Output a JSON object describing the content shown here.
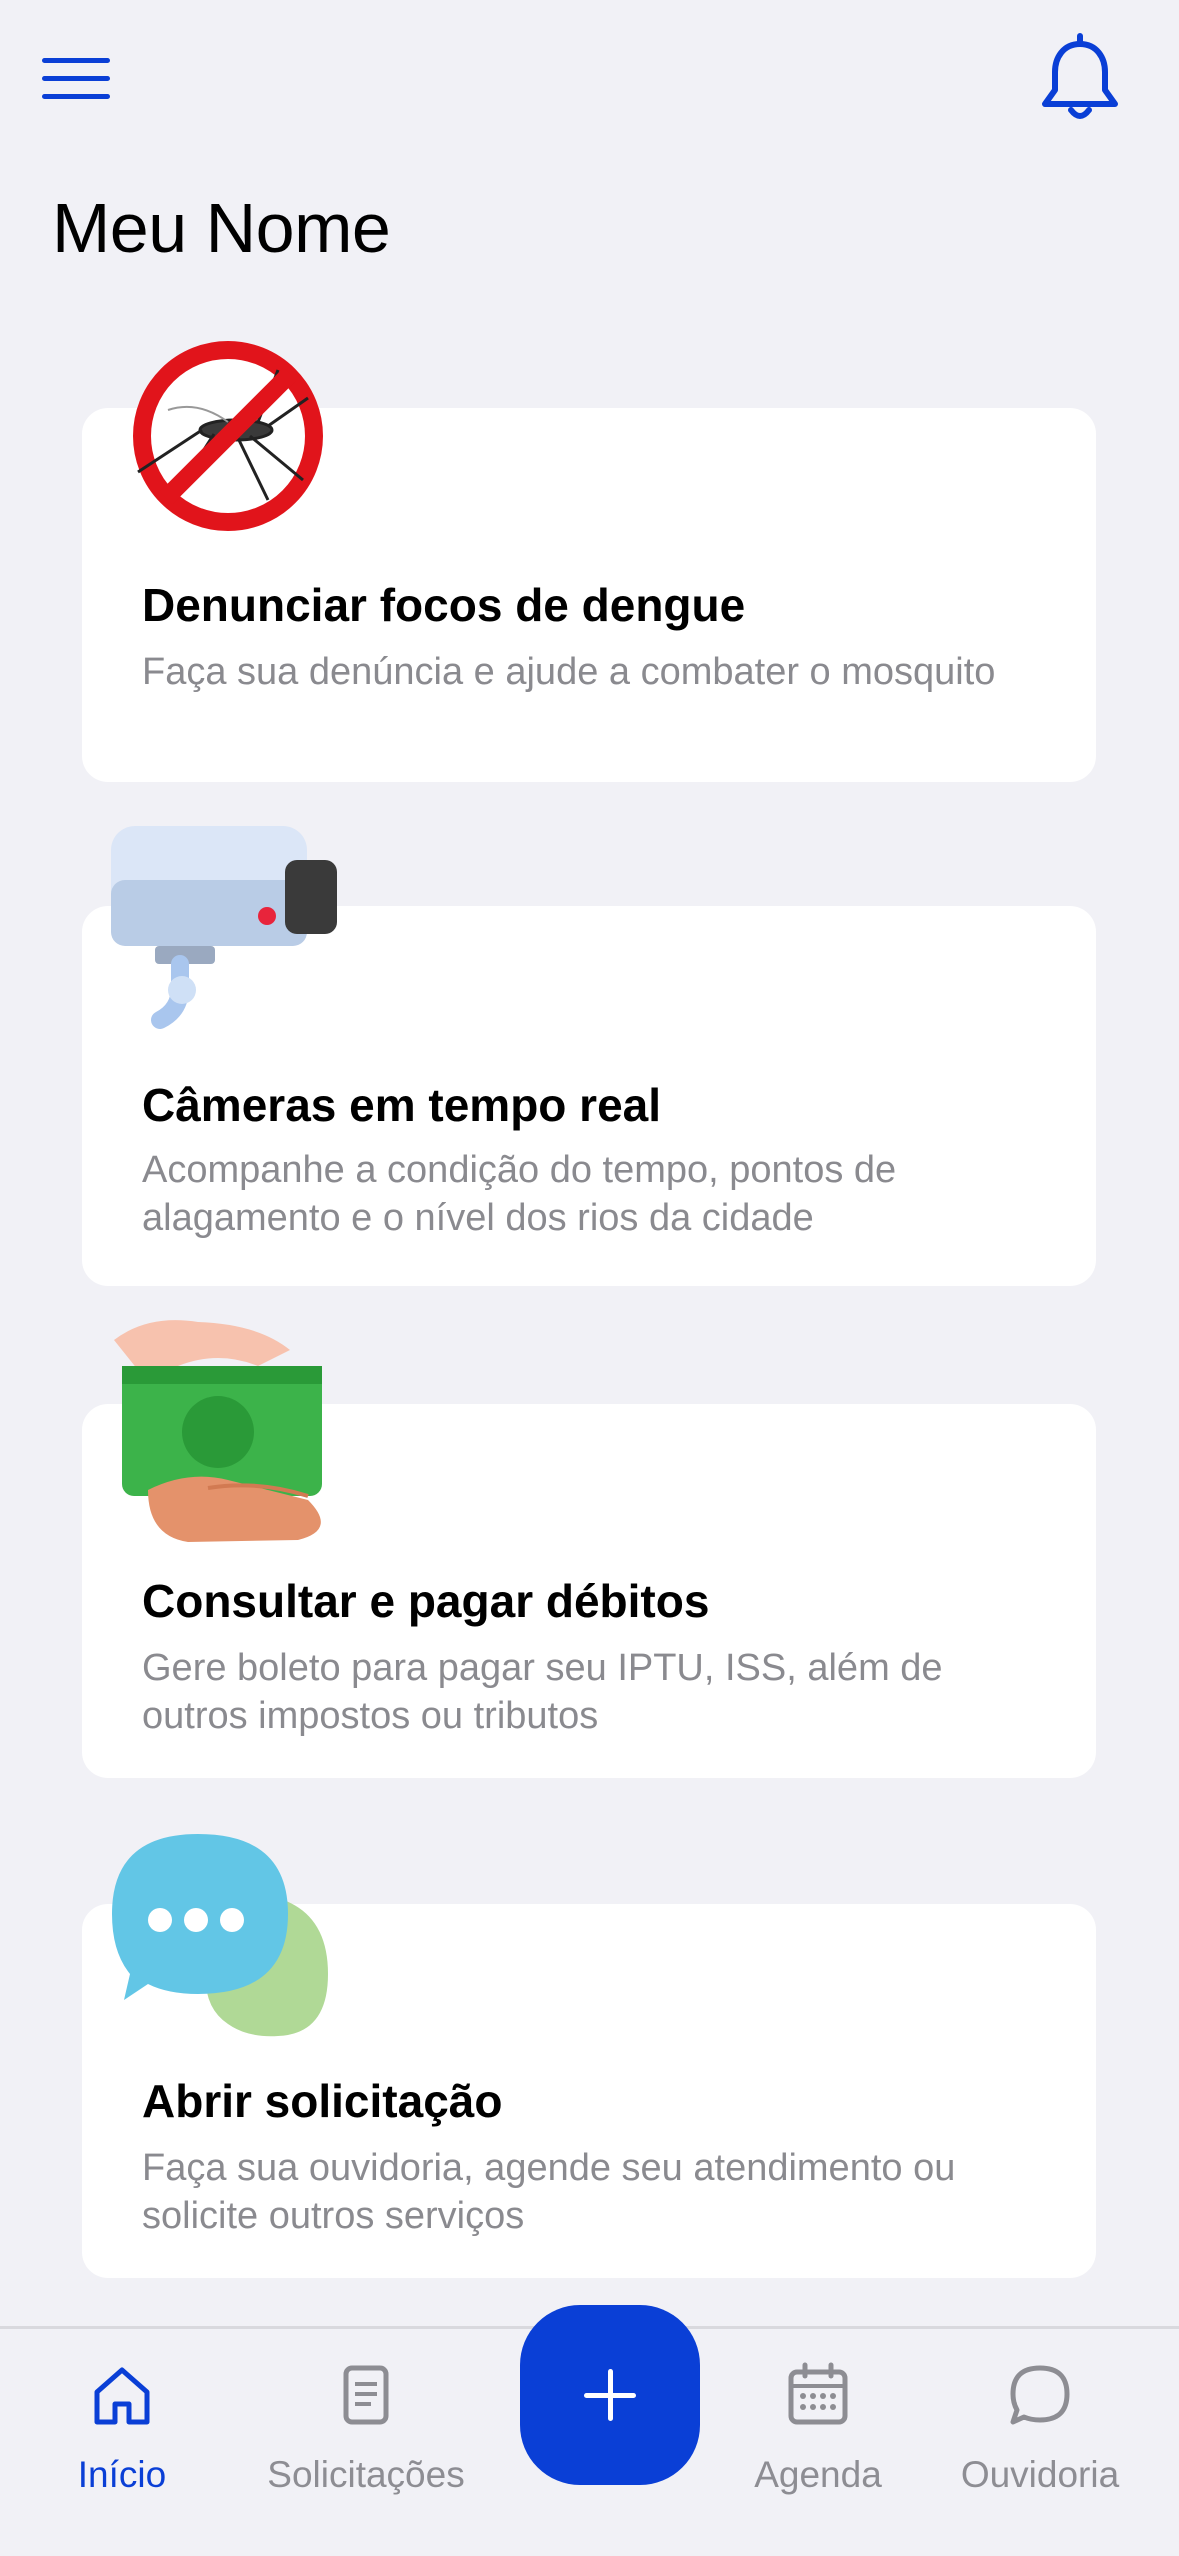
{
  "header": {
    "title": "Meu Nome"
  },
  "cards": [
    {
      "title": "Denunciar focos de dengue",
      "desc": "Faça sua denúncia e ajude a combater o mosquito",
      "icon": "no-mosquito-icon"
    },
    {
      "title": "Câmeras em tempo real",
      "desc": "Acompanhe a condição do tempo, pontos de alagamento e o nível dos rios da cidade",
      "icon": "security-camera-icon"
    },
    {
      "title": "Consultar e pagar débitos",
      "desc": "Gere boleto para pagar seu IPTU, ISS, além de outros impostos ou tributos",
      "icon": "money-hands-icon"
    },
    {
      "title": "Abrir solicitação",
      "desc": "Faça sua ouvidoria, agende seu atendimento ou solicite outros serviços",
      "icon": "chat-bubbles-icon"
    }
  ],
  "nav": {
    "items": [
      {
        "label": "Início",
        "icon": "home-icon",
        "active": true
      },
      {
        "label": "Solicitações",
        "icon": "document-icon",
        "active": false
      },
      {
        "label": "Agenda",
        "icon": "calendar-icon",
        "active": false
      },
      {
        "label": "Ouvidoria",
        "icon": "speech-bubble-icon",
        "active": false
      }
    ],
    "fab_icon": "plus-icon"
  },
  "colors": {
    "accent": "#0a3fd6",
    "background": "#f1f1f6",
    "card": "#ffffff",
    "muted_text": "#8a8a8f"
  }
}
